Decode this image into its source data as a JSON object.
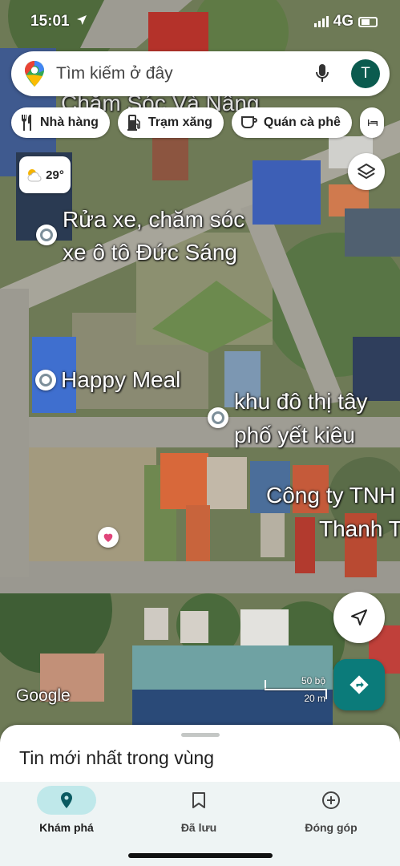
{
  "status": {
    "time": "15:01",
    "network": "4G"
  },
  "search": {
    "placeholder": "Tìm kiếm ở đây",
    "avatar_letter": "T"
  },
  "chips": [
    {
      "label": "Nhà hàng",
      "icon": "fork-knife-icon"
    },
    {
      "label": "Trạm xăng",
      "icon": "gas-pump-icon"
    },
    {
      "label": "Quán cà phê",
      "icon": "coffee-cup-icon"
    }
  ],
  "weather": {
    "temp": "29°",
    "icon": "partly-cloudy-icon"
  },
  "map_labels": {
    "top_faded": "Chăm Sóc Và Nâng",
    "car_wash_line1": "Rửa xe, chăm sóc",
    "car_wash_line2": "xe ô tô Đức Sáng",
    "happy_meal": "Happy Meal",
    "urban_line1": "khu đô thị tây",
    "urban_line2": "phố yết kiêu",
    "company_line1": "Công ty TNH",
    "company_line2": "Thanh T"
  },
  "map": {
    "attribution": "Google",
    "scale_top": "50 bộ",
    "scale_bottom": "20 m"
  },
  "sheet": {
    "title": "Tin mới nhất trong vùng"
  },
  "nav": [
    {
      "label": "Khám phá",
      "icon": "explore-pin-icon",
      "active": true
    },
    {
      "label": "Đã lưu",
      "icon": "bookmark-icon",
      "active": false
    },
    {
      "label": "Đóng góp",
      "icon": "add-circle-icon",
      "active": false
    }
  ],
  "colors": {
    "accent": "#0b7b7a",
    "avatar": "#0b5b4f",
    "nav_bg": "#eef4f4",
    "active_pill": "#bfe8ea"
  }
}
